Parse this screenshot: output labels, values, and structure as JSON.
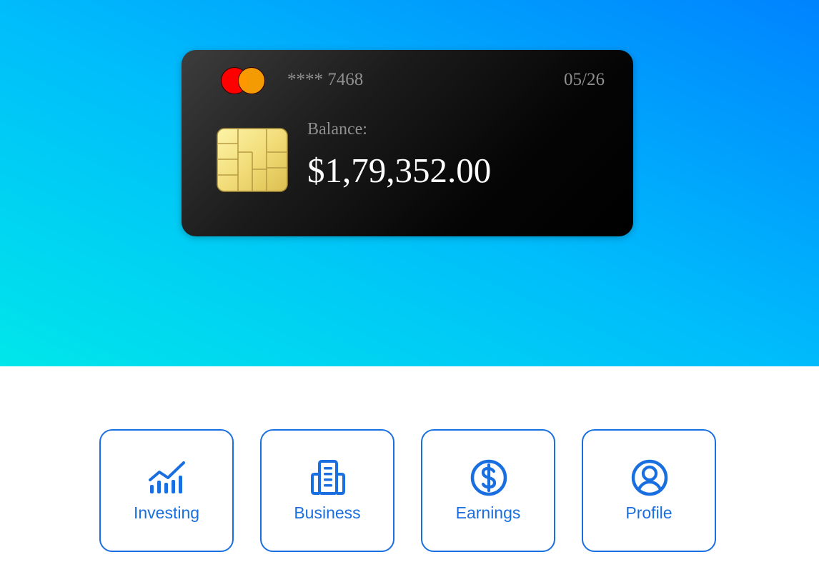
{
  "card": {
    "brand_icon": "mastercard-logo",
    "number": "**** 7468",
    "expiry": "05/26",
    "balance_label": "Balance:",
    "balance_value": "$1,79,352.00"
  },
  "actions": [
    {
      "label": "Investing",
      "icon": "chart-line-icon"
    },
    {
      "label": "Business",
      "icon": "building-icon"
    },
    {
      "label": "Earnings",
      "icon": "dollar-circle-icon"
    },
    {
      "label": "Profile",
      "icon": "user-circle-icon"
    }
  ],
  "colors": {
    "gradient_start": "#00e6ea",
    "gradient_end": "#0083fe",
    "accent": "#1a6fe0",
    "card_bg": "#000000"
  }
}
